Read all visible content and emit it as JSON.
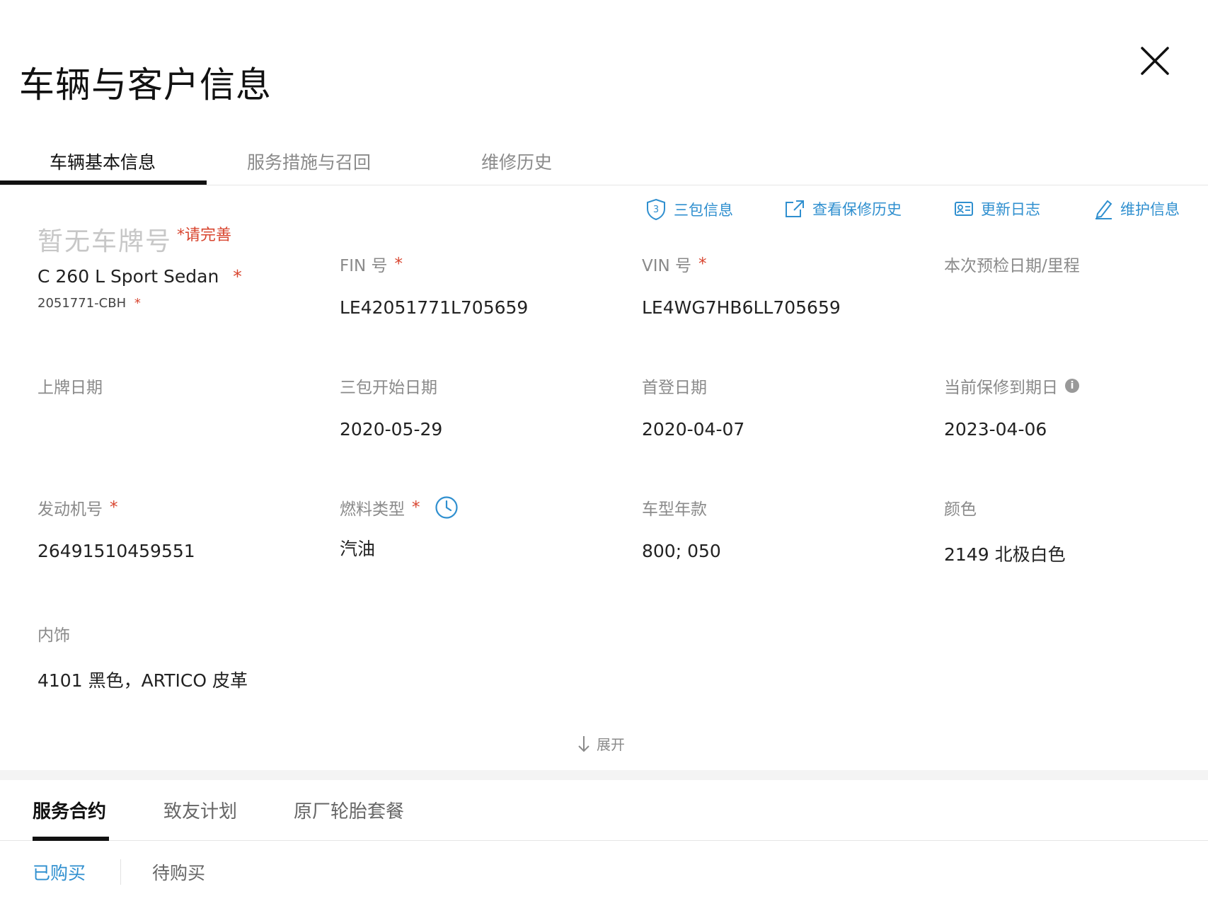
{
  "header": {
    "title": "车辆与客户信息"
  },
  "tabs_top": [
    "车辆基本信息",
    "服务措施与召回",
    "维修历史"
  ],
  "actions": {
    "three_guarantee": "三包信息",
    "warranty_history": "查看保修历史",
    "update_log": "更新日志",
    "maintain_info": "维护信息"
  },
  "vehicle": {
    "plate": "暂无车牌号",
    "plate_hint": "请完善",
    "model": "C 260 L Sport Sedan",
    "model_code": "2051771-CBH"
  },
  "fields": {
    "fin_label": "FIN 号",
    "fin_value": "LE42051771L705659",
    "vin_label": "VIN 号",
    "vin_value": "LE4WG7HB6LL705659",
    "inspection_label": "本次预检日期/里程",
    "plate_date_label": "上牌日期",
    "warranty_start_label": "三包开始日期",
    "warranty_start_value": "2020-05-29",
    "first_reg_label": "首登日期",
    "first_reg_value": "2020-04-07",
    "warranty_expiry_label": "当前保修到期日",
    "warranty_expiry_value": "2023-04-06",
    "engine_label": "发动机号",
    "engine_value": "26491510459551",
    "fuel_label": "燃料类型",
    "fuel_value": "汽油",
    "model_year_label": "车型年款",
    "model_year_value": "800; 050",
    "color_label": "颜色",
    "color_value": "2149 北极白色",
    "interior_label": "内饰",
    "interior_value": "4101 黑色，ARTICO 皮革"
  },
  "expand_label": "展开",
  "tabs_bottom": [
    "服务合约",
    "致友计划",
    "原厂轮胎套餐"
  ],
  "subtabs": [
    "已购买",
    "待购买"
  ],
  "required_mark": "*",
  "info_mark": "i",
  "colors": {
    "accent": "#2f8fcf",
    "required": "#d8452f",
    "label": "#8a8a8a"
  }
}
